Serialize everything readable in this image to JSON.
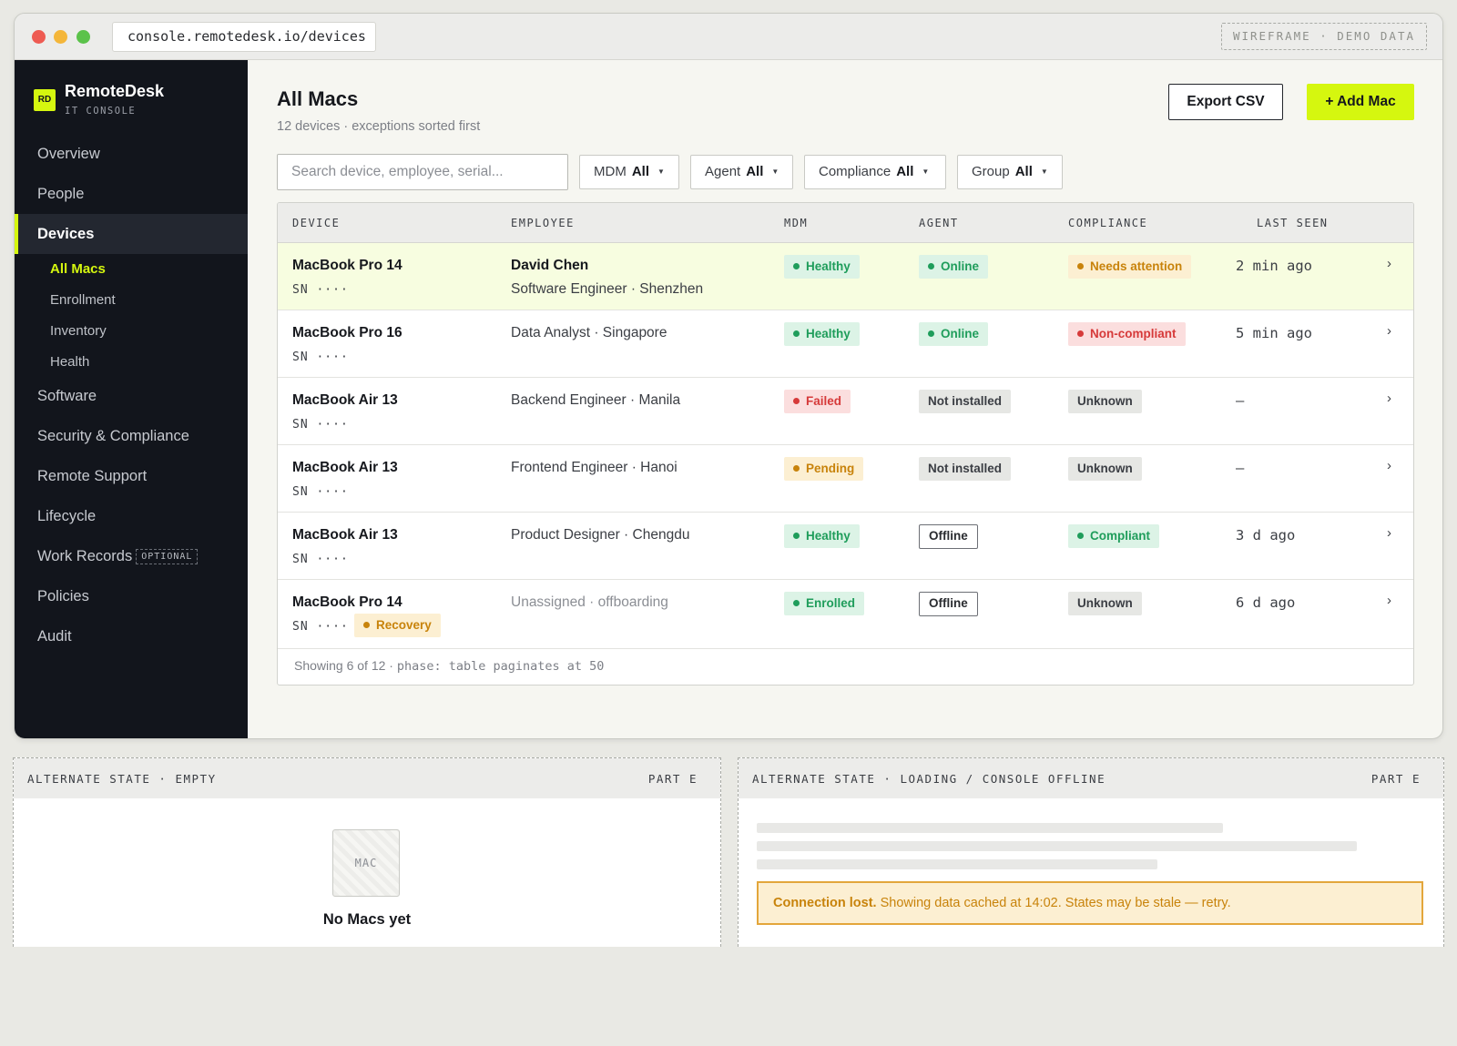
{
  "browser": {
    "url": "console.remotedesk.io/devices",
    "tag": "WIREFRAME · DEMO DATA"
  },
  "sidebar": {
    "brand_logo": "RD",
    "brand_name": "RemoteDesk",
    "brand_sub": "IT CONSOLE",
    "items": [
      {
        "label": "Overview"
      },
      {
        "label": "People"
      },
      {
        "label": "Devices"
      },
      {
        "label": "Software"
      },
      {
        "label": "Security & Compliance"
      },
      {
        "label": "Remote Support"
      },
      {
        "label": "Lifecycle"
      },
      {
        "label": "Work Records",
        "badge": "OPTIONAL"
      },
      {
        "label": "Policies"
      },
      {
        "label": "Audit"
      }
    ],
    "sub_items": [
      {
        "label": "All Macs"
      },
      {
        "label": "Enrollment"
      },
      {
        "label": "Inventory"
      },
      {
        "label": "Health"
      }
    ]
  },
  "main": {
    "title": "All Macs",
    "subtitle": "12 devices · exceptions sorted first",
    "export_label": "Export CSV",
    "add_label": "+ Add Mac",
    "search_placeholder": "Search device, employee, serial...",
    "filters": [
      {
        "label": "MDM",
        "value": "All"
      },
      {
        "label": "Agent",
        "value": "All"
      },
      {
        "label": "Compliance",
        "value": "All"
      },
      {
        "label": "Group",
        "value": "All"
      }
    ]
  },
  "table": {
    "columns": [
      "DEVICE",
      "EMPLOYEE",
      "MDM",
      "AGENT",
      "COMPLIANCE",
      "LAST SEEN"
    ],
    "rows": [
      {
        "device": "MacBook Pro 14",
        "sn": "SN ····",
        "employee": "David Chen",
        "role": "Software Engineer · Shenzhen",
        "mdm": "Healthy",
        "agent": "Online",
        "compliance": "Needs attention",
        "last_seen": "2 min ago"
      },
      {
        "device": "MacBook Pro 16",
        "sn": "SN ····",
        "employee": "",
        "role": "Data Analyst · Singapore",
        "mdm": "Healthy",
        "agent": "Online",
        "compliance": "Non-compliant",
        "last_seen": "5 min ago"
      },
      {
        "device": "MacBook Air 13",
        "sn": "SN ····",
        "employee": "",
        "role": "Backend Engineer · Manila",
        "mdm": "Failed",
        "agent": "Not installed",
        "compliance": "Unknown",
        "last_seen": "–"
      },
      {
        "device": "MacBook Air 13",
        "sn": "SN ····",
        "employee": "",
        "role": "Frontend Engineer · Hanoi",
        "mdm": "Pending",
        "agent": "Not installed",
        "compliance": "Unknown",
        "last_seen": "–"
      },
      {
        "device": "MacBook Air 13",
        "sn": "SN ····",
        "employee": "",
        "role": "Product Designer · Chengdu",
        "mdm": "Healthy",
        "agent": "Offline",
        "compliance": "Compliant",
        "last_seen": "3 d ago"
      },
      {
        "device": "MacBook Pro 14",
        "sn": "SN ····",
        "sn_badge": "Recovery",
        "employee": "",
        "role": "Unassigned · offboarding",
        "mdm": "Enrolled",
        "agent": "Offline",
        "compliance": "Unknown",
        "last_seen": "6 d ago"
      }
    ],
    "chevron": "›",
    "footer_text": "Showing 6 of 12 · ",
    "footer_mono": "phase: table paginates at 50"
  },
  "alt_empty": {
    "label": "ALTERNATE STATE · EMPTY",
    "part": "PART E",
    "icon_text": "MAC",
    "title": "No Macs yet"
  },
  "alt_offline": {
    "label": "ALTERNATE STATE · LOADING / CONSOLE OFFLINE",
    "part": "PART E",
    "alert_strong": "Connection lost.",
    "alert_text": " Showing data cached at 14:02. States may be stale — retry."
  },
  "colors": {
    "accent": "#d5f70f",
    "sidebar_bg": "#12151c",
    "healthy": "#1f9d5b",
    "failed": "#d63a3a",
    "pending": "#c8830b"
  }
}
